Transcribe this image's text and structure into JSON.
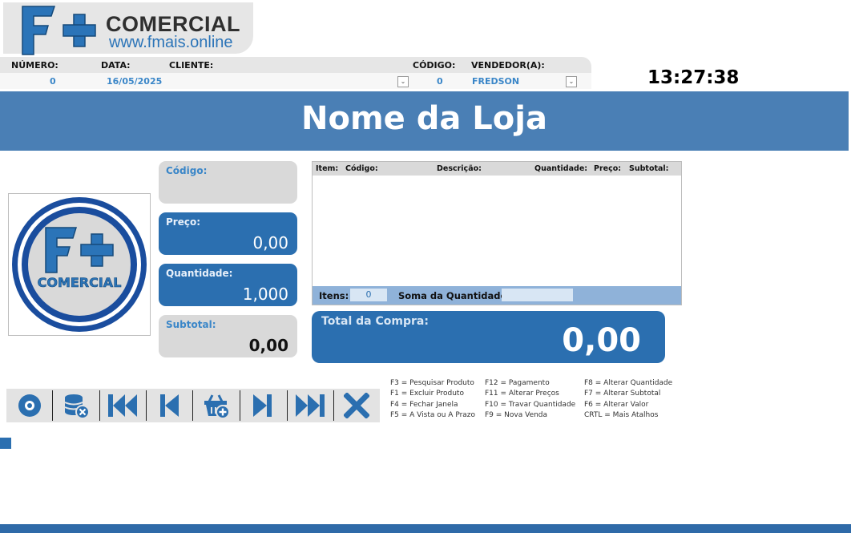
{
  "brand": {
    "title": "COMERCIAL",
    "url": "www.fmais.online",
    "logo_text": "F+",
    "logo_caption": "COMERCIAL"
  },
  "order": {
    "numero_label": "NÚMERO:",
    "numero": "0",
    "data_label": "DATA:",
    "data": "16/05/2025",
    "cliente_label": "CLIENTE:",
    "cliente": "",
    "codigo_label": "CÓDIGO:",
    "codigo": "0",
    "vendedor_label": "VENDEDOR(A):",
    "vendedor": "FREDSON"
  },
  "clock": "13:27:38",
  "store_name": "Nome da Loja",
  "fields": {
    "codigo_label": "Código:",
    "codigo": "",
    "preco_label": "Preço:",
    "preco": "0,00",
    "quantidade_label": "Quantidade:",
    "quantidade": "1,000",
    "subtotal_label": "Subtotal:",
    "subtotal": "0,00"
  },
  "grid": {
    "columns": [
      "Item:",
      "Código:",
      "Descrição:",
      "Quantidade:",
      "Preço:",
      "Subtotal:"
    ],
    "rows": [],
    "itens_label": "Itens:",
    "itens": "0",
    "soma_label": "Soma da Quantidade:",
    "soma": ""
  },
  "total": {
    "label": "Total da Compra:",
    "value": "0,00"
  },
  "toolbar": [
    "disc-icon",
    "database-remove-icon",
    "first-record-icon",
    "previous-record-icon",
    "basket-add-icon",
    "next-record-icon",
    "last-record-icon",
    "close-icon"
  ],
  "shortcuts": {
    "col1": [
      "F3 = Pesquisar Produto",
      "F1 = Excluir Produto",
      "F4 = Fechar Janela",
      "F5 = A Vista ou A Prazo"
    ],
    "col2": [
      "F12 = Pagamento",
      "F11 = Alterar Preços",
      "F10 = Travar Quantidade",
      "F9 = Nova Venda"
    ],
    "col3": [
      "F8 = Alterar Quantidade",
      "F7 = Alterar Subtotal",
      "F6 = Alterar Valor",
      "CRTL = Mais Atalhos"
    ]
  },
  "colors": {
    "primary": "#2b6fb0",
    "banner": "#4a7fb5",
    "panel": "#d9d9d9",
    "accent_text": "#3a86c8"
  }
}
